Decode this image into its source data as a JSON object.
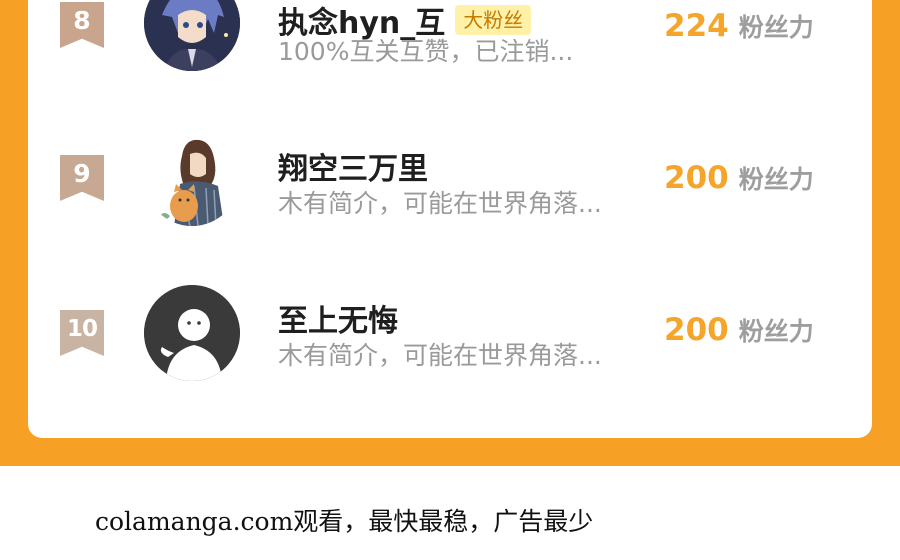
{
  "colors": {
    "orange_background": "#f7a026",
    "card_background": "#ffffff",
    "score_color": "#f4a52a",
    "name_color": "#1f1f1f",
    "bio_color": "#9a9a9a",
    "badge_8": "#c9a58e",
    "badge_9": "#c7a993",
    "badge_10": "#c9b3a2"
  },
  "ranking": [
    {
      "rank": "8",
      "name": "执念hyn_互",
      "tag": "大粉丝",
      "bio": "100%互关互赞，已注销...",
      "score": "224",
      "unit": "粉丝力",
      "avatar_icon": "anime-character-avatar"
    },
    {
      "rank": "9",
      "name": "翔空三万里",
      "tag": "",
      "bio": "木有简介，可能在世界角落...",
      "score": "200",
      "unit": "粉丝力",
      "avatar_icon": "illustrated-person-with-cat-avatar"
    },
    {
      "rank": "10",
      "name": "至上无悔",
      "tag": "",
      "bio": "木有简介，可能在世界角落...",
      "score": "200",
      "unit": "粉丝力",
      "avatar_icon": "default-user-avatar"
    }
  ],
  "footer": {
    "text": "colamanga.com观看，最快最稳，广告最少"
  }
}
